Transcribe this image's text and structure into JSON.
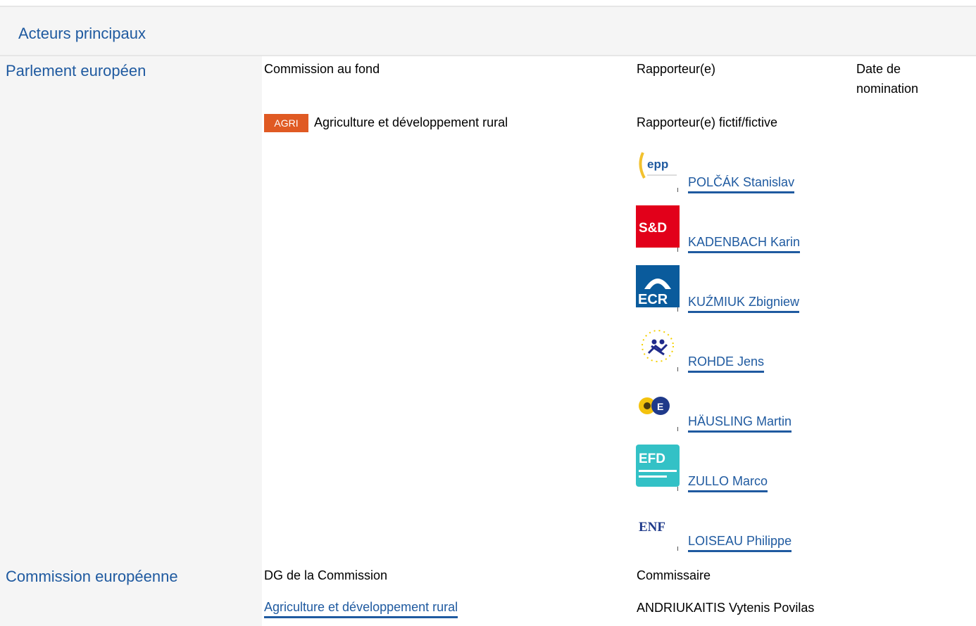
{
  "header": {
    "title": "Acteurs principaux"
  },
  "parlement": {
    "label": "Parlement européen",
    "col_committee": "Commission au fond",
    "col_rapporteur": "Rapporteur(e)",
    "col_date": "Date de nomination",
    "committee_badge": "AGRI",
    "committee_name": "Agriculture et développement rural",
    "shadow_title": "Rapporteur(e) fictif/fictive",
    "shadows": [
      {
        "name": "POLČÁK Stanislav",
        "logo": "epp",
        "logo_text": "epp"
      },
      {
        "name": "KADENBACH Karin",
        "logo": "sd",
        "logo_text": "S&D"
      },
      {
        "name": "KUŹMIUK Zbigniew",
        "logo": "ecr",
        "logo_text": "ECR"
      },
      {
        "name": "ROHDE Jens",
        "logo": "alde"
      },
      {
        "name": "HÄUSLING Martin",
        "logo": "greens"
      },
      {
        "name": "ZULLO Marco",
        "logo": "efdd",
        "logo_text": "EFD"
      },
      {
        "name": "LOISEAU Philippe",
        "logo": "enf",
        "logo_text": "ENF"
      }
    ]
  },
  "commission": {
    "label": "Commission européenne",
    "col_dg": "DG de la Commission",
    "col_commissioner": "Commissaire",
    "dg_name": "Agriculture et développement rural",
    "commissioner": "ANDRIUKAITIS Vytenis Povilas"
  },
  "colors": {
    "link": "#1f5aa0",
    "badge": "#e05a23",
    "panel": "#f5f5f5"
  }
}
